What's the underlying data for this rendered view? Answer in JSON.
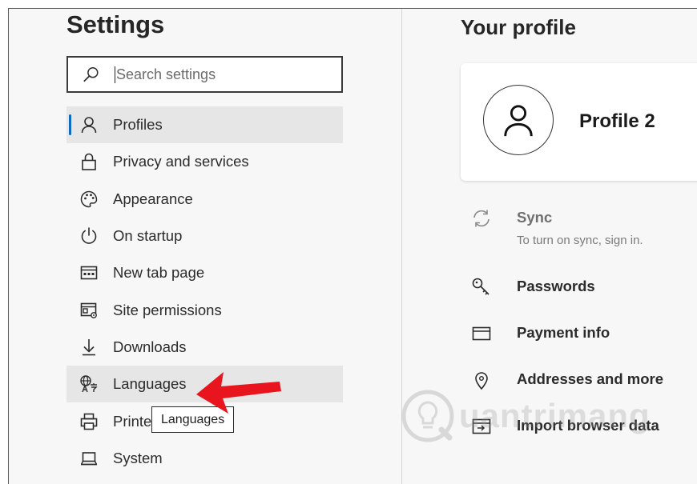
{
  "settings": {
    "title": "Settings",
    "search_placeholder": "Search settings"
  },
  "nav": {
    "items": [
      {
        "label": "Profiles",
        "icon": "person-icon",
        "active": true
      },
      {
        "label": "Privacy and services",
        "icon": "lock-icon"
      },
      {
        "label": "Appearance",
        "icon": "palette-icon"
      },
      {
        "label": "On startup",
        "icon": "power-icon"
      },
      {
        "label": "New tab page",
        "icon": "new-tab-icon"
      },
      {
        "label": "Site permissions",
        "icon": "site-permissions-icon"
      },
      {
        "label": "Downloads",
        "icon": "download-icon"
      },
      {
        "label": "Languages",
        "icon": "languages-icon",
        "hovered": true
      },
      {
        "label": "Printers",
        "icon": "printer-icon"
      },
      {
        "label": "System",
        "icon": "laptop-icon"
      }
    ],
    "tooltip": "Languages",
    "accent_color": "#0f6cbd"
  },
  "profile": {
    "title": "Your profile",
    "name": "Profile 2",
    "items": [
      {
        "label": "Sync",
        "sub": "To turn on sync, sign in.",
        "icon": "sync-icon"
      },
      {
        "label": "Passwords",
        "icon": "key-icon"
      },
      {
        "label": "Payment info",
        "icon": "card-icon"
      },
      {
        "label": "Addresses and more",
        "icon": "location-pin-icon"
      },
      {
        "label": "Import browser data",
        "icon": "import-icon"
      }
    ]
  },
  "annotation": {
    "arrow_color": "#e8141e"
  },
  "watermark": {
    "text": "uantrimang"
  }
}
